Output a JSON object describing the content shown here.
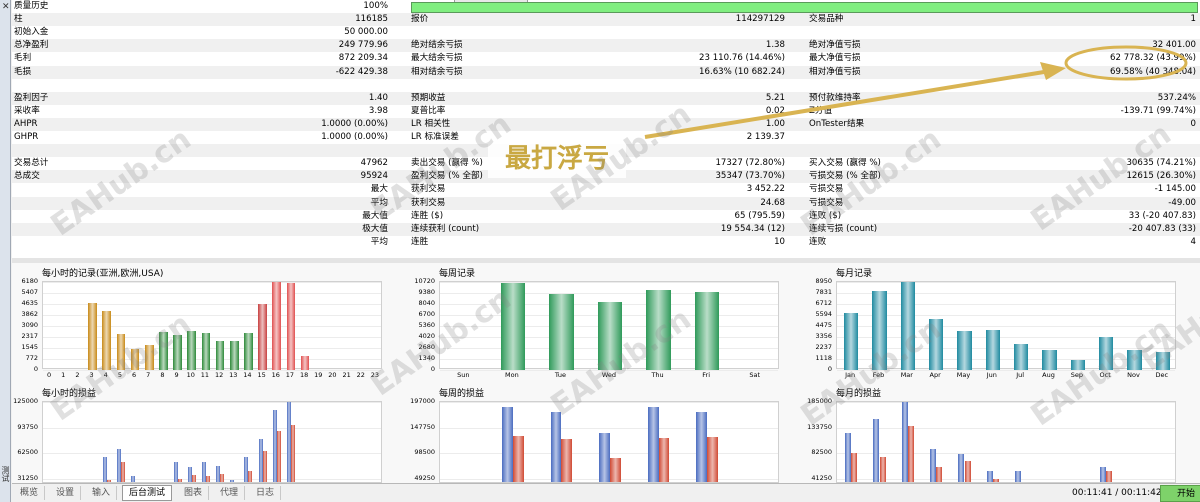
{
  "report": {
    "rows": [
      {
        "alt": false,
        "cells": [
          [
            "质量历史",
            "100%"
          ]
        ],
        "qbar": true
      },
      {
        "alt": true,
        "cells": [
          [
            "柱",
            "116185"
          ],
          [
            "报价",
            "114297129"
          ],
          [
            "交易品种",
            "1"
          ]
        ]
      },
      {
        "alt": false,
        "cells": [
          [
            "初始入金",
            "50 000.00"
          ]
        ]
      },
      {
        "alt": true,
        "cells": [
          [
            "总净盈利",
            "249 779.96"
          ],
          [
            "绝对结余亏损",
            "1.38"
          ],
          [
            "绝对净值亏损",
            "32 401.00"
          ]
        ]
      },
      {
        "alt": false,
        "cells": [
          [
            "毛利",
            "872 209.34"
          ],
          [
            "最大结余亏损",
            "23 110.76 (14.46%)"
          ],
          [
            "最大净值亏损",
            "62 778.32 (43.99%)"
          ]
        ]
      },
      {
        "alt": true,
        "cells": [
          [
            "毛损",
            "-622 429.38"
          ],
          [
            "相对结余亏损",
            "16.63% (10 682.24)"
          ],
          [
            "相对净值亏损",
            "69.58% (40 348.04)"
          ]
        ]
      },
      {
        "alt": false,
        "cells": []
      },
      {
        "alt": true,
        "cells": [
          [
            "盈利因子",
            "1.40"
          ],
          [
            "预期收益",
            "5.21"
          ],
          [
            "预付款维持率",
            "537.24%"
          ]
        ]
      },
      {
        "alt": false,
        "cells": [
          [
            "采收率",
            "3.98"
          ],
          [
            "夏普比率",
            "0.02"
          ],
          [
            "Z分值",
            "-139.71 (99.74%)"
          ]
        ]
      },
      {
        "alt": true,
        "cells": [
          [
            "AHPR",
            "1.0000 (0.00%)"
          ],
          [
            "LR 相关性",
            "1.00"
          ],
          [
            "OnTester结果",
            "0"
          ]
        ]
      },
      {
        "alt": false,
        "cells": [
          [
            "GHPR",
            "1.0000 (0.00%)"
          ],
          [
            "LR 标准误差",
            "2 139.37"
          ]
        ]
      },
      {
        "alt": true,
        "cells": []
      },
      {
        "alt": false,
        "cells": [
          [
            "交易总计",
            "47962"
          ],
          [
            "卖出交易 (赢得 %)",
            "17327 (72.80%)"
          ],
          [
            "买入交易 (赢得 %)",
            "30635 (74.21%)"
          ]
        ]
      },
      {
        "alt": true,
        "cells": [
          [
            "总成交",
            "95924"
          ],
          [
            "盈利交易 (% 全部)",
            "35347 (73.70%)"
          ],
          [
            "亏损交易 (% 全部)",
            "12615 (26.30%)"
          ]
        ]
      },
      {
        "alt": false,
        "cells": [
          [
            "最大",
            "获利交易",
            "3 452.22"
          ],
          [
            "亏损交易",
            "-1 145.00"
          ]
        ],
        "rlabel": true
      },
      {
        "alt": true,
        "cells": [
          [
            "平均",
            "获利交易",
            "24.68"
          ],
          [
            "亏损交易",
            "-49.00"
          ]
        ],
        "rlabel": true
      },
      {
        "alt": false,
        "cells": [
          [
            "最大值",
            "连胜 ($)",
            "65 (795.59)"
          ],
          [
            "连败 ($)",
            "33 (-20 407.83)"
          ]
        ],
        "rlabel": true
      },
      {
        "alt": true,
        "cells": [
          [
            "极大值",
            "连续获利 (count)",
            "19 554.34 (12)"
          ],
          [
            "连续亏损 (count)",
            "-20 407.83 (33)"
          ]
        ],
        "rlabel": true
      },
      {
        "alt": false,
        "cells": [
          [
            "平均",
            "连胜",
            "10"
          ],
          [
            "连败",
            "4"
          ]
        ],
        "rlabel": true
      }
    ]
  },
  "charts": [
    {
      "id": "hourly-trades",
      "title": "每小时的记录(亚洲,欧洲,USA)",
      "yticks": [
        "6180",
        "5407",
        "4635",
        "3862",
        "3090",
        "2317",
        "1545",
        "772",
        "0"
      ],
      "ymax": 6180,
      "xlabels": [
        "0",
        "1",
        "2",
        "3",
        "4",
        "5",
        "6",
        "7",
        "8",
        "9",
        "10",
        "11",
        "12",
        "13",
        "14",
        "15",
        "16",
        "17",
        "18",
        "19",
        "20",
        "21",
        "22",
        "23"
      ],
      "values": [
        0,
        0,
        0,
        4700,
        4150,
        2550,
        1500,
        1750,
        2650,
        2450,
        2750,
        2600,
        2050,
        2050,
        2600,
        4600,
        6150,
        6100,
        950,
        0,
        0,
        0,
        0,
        0
      ],
      "colors": [
        "#c88a18",
        "#c88a18",
        "#c88a18",
        "#c88a18",
        "#c88a18",
        "#c88a18",
        "#c88a18",
        "#c88a18",
        "#2e8a3a",
        "#2e8a3a",
        "#2e8a3a",
        "#2e8a3a",
        "#2e8a3a",
        "#2e8a3a",
        "#2e8a3a",
        "#c84040",
        "#e05050",
        "#e05050",
        "#e05050",
        "#c84040",
        "#c84040",
        "#c84040",
        "#c84040",
        "#c84040"
      ]
    },
    {
      "id": "weekly-trades",
      "title": "每周记录",
      "yticks": [
        "10720",
        "9380",
        "8040",
        "6700",
        "5360",
        "4020",
        "2680",
        "1340",
        "0"
      ],
      "ymax": 10720,
      "xlabels": [
        "Sun",
        "Mon",
        "Tue",
        "Wed",
        "Thu",
        "Fri",
        "Sat"
      ],
      "values": [
        0,
        10600,
        9300,
        8300,
        9800,
        9500,
        0
      ],
      "colors": [
        "#2f9a5a",
        "#2f9a5a",
        "#2f9a5a",
        "#2f9a5a",
        "#2f9a5a",
        "#2f9a5a",
        "#2f9a5a"
      ]
    },
    {
      "id": "monthly-trades",
      "title": "每月记录",
      "yticks": [
        "8950",
        "7831",
        "6712",
        "5594",
        "4475",
        "3356",
        "2237",
        "1118",
        "0"
      ],
      "ymax": 8950,
      "xlabels": [
        "Jan",
        "Feb",
        "Mar",
        "Apr",
        "May",
        "Jun",
        "Jul",
        "Aug",
        "Sep",
        "Oct",
        "Nov",
        "Dec"
      ],
      "values": [
        5750,
        8050,
        8900,
        5150,
        3950,
        4100,
        2600,
        2050,
        1050,
        3350,
        2000,
        1850
      ],
      "colors": [
        "#1f8aa0",
        "#1f8aa0",
        "#1f8aa0",
        "#1f8aa0",
        "#1f8aa0",
        "#1f8aa0",
        "#1f8aa0",
        "#1f8aa0",
        "#1f8aa0",
        "#1f8aa0",
        "#1f8aa0",
        "#1f8aa0"
      ]
    },
    {
      "id": "hourly-pl",
      "title": "每小时的损益",
      "yticks": [
        "125000",
        "93750",
        "62500",
        "31250"
      ],
      "ymax": 125000,
      "series": [
        {
          "color": "#4a6cc0",
          "values": [
            0,
            0,
            1200,
            0,
            57000,
            68000,
            34000,
            10000,
            0,
            51000,
            45000,
            51000,
            46000,
            30000,
            57000,
            80000,
            115000,
            125000,
            0,
            5000,
            0,
            0,
            0,
            0
          ]
        },
        {
          "color": "#d04a34",
          "values": [
            0,
            0,
            2300,
            0,
            30000,
            52000,
            22000,
            6000,
            0,
            31000,
            35000,
            34000,
            37000,
            20000,
            40000,
            65000,
            90000,
            97000,
            0,
            4500,
            0,
            0,
            0,
            0
          ]
        }
      ]
    },
    {
      "id": "weekly-pl",
      "title": "每周的损益",
      "yticks": [
        "197000",
        "147750",
        "98500",
        "49250"
      ],
      "ymax": 197000,
      "series": [
        {
          "color": "#4a6cc0",
          "values": [
            0,
            188000,
            178000,
            138000,
            188000,
            178000,
            0
          ]
        },
        {
          "color": "#d04a34",
          "values": [
            0,
            132000,
            125000,
            88000,
            127000,
            129000,
            0
          ]
        }
      ]
    },
    {
      "id": "monthly-pl",
      "title": "每月的损益",
      "yticks": [
        "185000",
        "133750",
        "82500",
        "41250"
      ],
      "ymax": 185000,
      "series": [
        {
          "color": "#4a6cc0",
          "values": [
            128000,
            155000,
            185000,
            100000,
            90000,
            60000,
            60000,
            40000,
            0,
            67000,
            40000,
            35000
          ]
        },
        {
          "color": "#d04a34",
          "values": [
            92000,
            85000,
            141000,
            67000,
            78000,
            45000,
            34000,
            21000,
            0,
            59000,
            30000,
            23000
          ]
        }
      ]
    }
  ],
  "tabs": [
    "概览",
    "设置",
    "输入",
    "后台测试",
    "图表",
    "代理",
    "日志"
  ],
  "active_tab": "后台测试",
  "status": {
    "time": "00:11:41 / 00:11:42",
    "start": "开始"
  },
  "leftbar": {
    "close": "✕",
    "vertical": "测试"
  },
  "annotation": {
    "text": "最打浮亏"
  },
  "watermark": "EAHub.cn"
}
